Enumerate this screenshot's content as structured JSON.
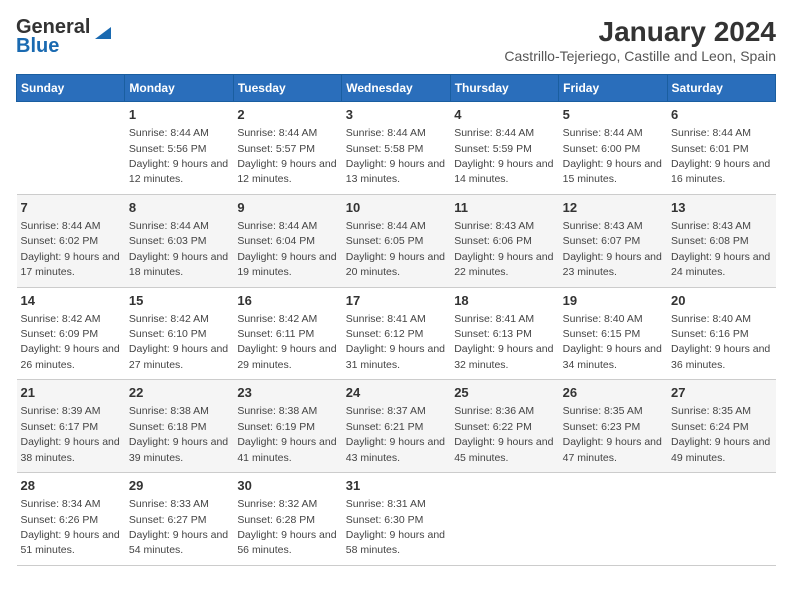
{
  "logo": {
    "general": "General",
    "blue": "Blue"
  },
  "title": "January 2024",
  "subtitle": "Castrillo-Tejeriego, Castille and Leon, Spain",
  "days_of_week": [
    "Sunday",
    "Monday",
    "Tuesday",
    "Wednesday",
    "Thursday",
    "Friday",
    "Saturday"
  ],
  "weeks": [
    [
      {
        "num": "",
        "sunrise": "",
        "sunset": "",
        "daylight": ""
      },
      {
        "num": "1",
        "sunrise": "Sunrise: 8:44 AM",
        "sunset": "Sunset: 5:56 PM",
        "daylight": "Daylight: 9 hours and 12 minutes."
      },
      {
        "num": "2",
        "sunrise": "Sunrise: 8:44 AM",
        "sunset": "Sunset: 5:57 PM",
        "daylight": "Daylight: 9 hours and 12 minutes."
      },
      {
        "num": "3",
        "sunrise": "Sunrise: 8:44 AM",
        "sunset": "Sunset: 5:58 PM",
        "daylight": "Daylight: 9 hours and 13 minutes."
      },
      {
        "num": "4",
        "sunrise": "Sunrise: 8:44 AM",
        "sunset": "Sunset: 5:59 PM",
        "daylight": "Daylight: 9 hours and 14 minutes."
      },
      {
        "num": "5",
        "sunrise": "Sunrise: 8:44 AM",
        "sunset": "Sunset: 6:00 PM",
        "daylight": "Daylight: 9 hours and 15 minutes."
      },
      {
        "num": "6",
        "sunrise": "Sunrise: 8:44 AM",
        "sunset": "Sunset: 6:01 PM",
        "daylight": "Daylight: 9 hours and 16 minutes."
      }
    ],
    [
      {
        "num": "7",
        "sunrise": "Sunrise: 8:44 AM",
        "sunset": "Sunset: 6:02 PM",
        "daylight": "Daylight: 9 hours and 17 minutes."
      },
      {
        "num": "8",
        "sunrise": "Sunrise: 8:44 AM",
        "sunset": "Sunset: 6:03 PM",
        "daylight": "Daylight: 9 hours and 18 minutes."
      },
      {
        "num": "9",
        "sunrise": "Sunrise: 8:44 AM",
        "sunset": "Sunset: 6:04 PM",
        "daylight": "Daylight: 9 hours and 19 minutes."
      },
      {
        "num": "10",
        "sunrise": "Sunrise: 8:44 AM",
        "sunset": "Sunset: 6:05 PM",
        "daylight": "Daylight: 9 hours and 20 minutes."
      },
      {
        "num": "11",
        "sunrise": "Sunrise: 8:43 AM",
        "sunset": "Sunset: 6:06 PM",
        "daylight": "Daylight: 9 hours and 22 minutes."
      },
      {
        "num": "12",
        "sunrise": "Sunrise: 8:43 AM",
        "sunset": "Sunset: 6:07 PM",
        "daylight": "Daylight: 9 hours and 23 minutes."
      },
      {
        "num": "13",
        "sunrise": "Sunrise: 8:43 AM",
        "sunset": "Sunset: 6:08 PM",
        "daylight": "Daylight: 9 hours and 24 minutes."
      }
    ],
    [
      {
        "num": "14",
        "sunrise": "Sunrise: 8:42 AM",
        "sunset": "Sunset: 6:09 PM",
        "daylight": "Daylight: 9 hours and 26 minutes."
      },
      {
        "num": "15",
        "sunrise": "Sunrise: 8:42 AM",
        "sunset": "Sunset: 6:10 PM",
        "daylight": "Daylight: 9 hours and 27 minutes."
      },
      {
        "num": "16",
        "sunrise": "Sunrise: 8:42 AM",
        "sunset": "Sunset: 6:11 PM",
        "daylight": "Daylight: 9 hours and 29 minutes."
      },
      {
        "num": "17",
        "sunrise": "Sunrise: 8:41 AM",
        "sunset": "Sunset: 6:12 PM",
        "daylight": "Daylight: 9 hours and 31 minutes."
      },
      {
        "num": "18",
        "sunrise": "Sunrise: 8:41 AM",
        "sunset": "Sunset: 6:13 PM",
        "daylight": "Daylight: 9 hours and 32 minutes."
      },
      {
        "num": "19",
        "sunrise": "Sunrise: 8:40 AM",
        "sunset": "Sunset: 6:15 PM",
        "daylight": "Daylight: 9 hours and 34 minutes."
      },
      {
        "num": "20",
        "sunrise": "Sunrise: 8:40 AM",
        "sunset": "Sunset: 6:16 PM",
        "daylight": "Daylight: 9 hours and 36 minutes."
      }
    ],
    [
      {
        "num": "21",
        "sunrise": "Sunrise: 8:39 AM",
        "sunset": "Sunset: 6:17 PM",
        "daylight": "Daylight: 9 hours and 38 minutes."
      },
      {
        "num": "22",
        "sunrise": "Sunrise: 8:38 AM",
        "sunset": "Sunset: 6:18 PM",
        "daylight": "Daylight: 9 hours and 39 minutes."
      },
      {
        "num": "23",
        "sunrise": "Sunrise: 8:38 AM",
        "sunset": "Sunset: 6:19 PM",
        "daylight": "Daylight: 9 hours and 41 minutes."
      },
      {
        "num": "24",
        "sunrise": "Sunrise: 8:37 AM",
        "sunset": "Sunset: 6:21 PM",
        "daylight": "Daylight: 9 hours and 43 minutes."
      },
      {
        "num": "25",
        "sunrise": "Sunrise: 8:36 AM",
        "sunset": "Sunset: 6:22 PM",
        "daylight": "Daylight: 9 hours and 45 minutes."
      },
      {
        "num": "26",
        "sunrise": "Sunrise: 8:35 AM",
        "sunset": "Sunset: 6:23 PM",
        "daylight": "Daylight: 9 hours and 47 minutes."
      },
      {
        "num": "27",
        "sunrise": "Sunrise: 8:35 AM",
        "sunset": "Sunset: 6:24 PM",
        "daylight": "Daylight: 9 hours and 49 minutes."
      }
    ],
    [
      {
        "num": "28",
        "sunrise": "Sunrise: 8:34 AM",
        "sunset": "Sunset: 6:26 PM",
        "daylight": "Daylight: 9 hours and 51 minutes."
      },
      {
        "num": "29",
        "sunrise": "Sunrise: 8:33 AM",
        "sunset": "Sunset: 6:27 PM",
        "daylight": "Daylight: 9 hours and 54 minutes."
      },
      {
        "num": "30",
        "sunrise": "Sunrise: 8:32 AM",
        "sunset": "Sunset: 6:28 PM",
        "daylight": "Daylight: 9 hours and 56 minutes."
      },
      {
        "num": "31",
        "sunrise": "Sunrise: 8:31 AM",
        "sunset": "Sunset: 6:30 PM",
        "daylight": "Daylight: 9 hours and 58 minutes."
      },
      {
        "num": "",
        "sunrise": "",
        "sunset": "",
        "daylight": ""
      },
      {
        "num": "",
        "sunrise": "",
        "sunset": "",
        "daylight": ""
      },
      {
        "num": "",
        "sunrise": "",
        "sunset": "",
        "daylight": ""
      }
    ]
  ]
}
